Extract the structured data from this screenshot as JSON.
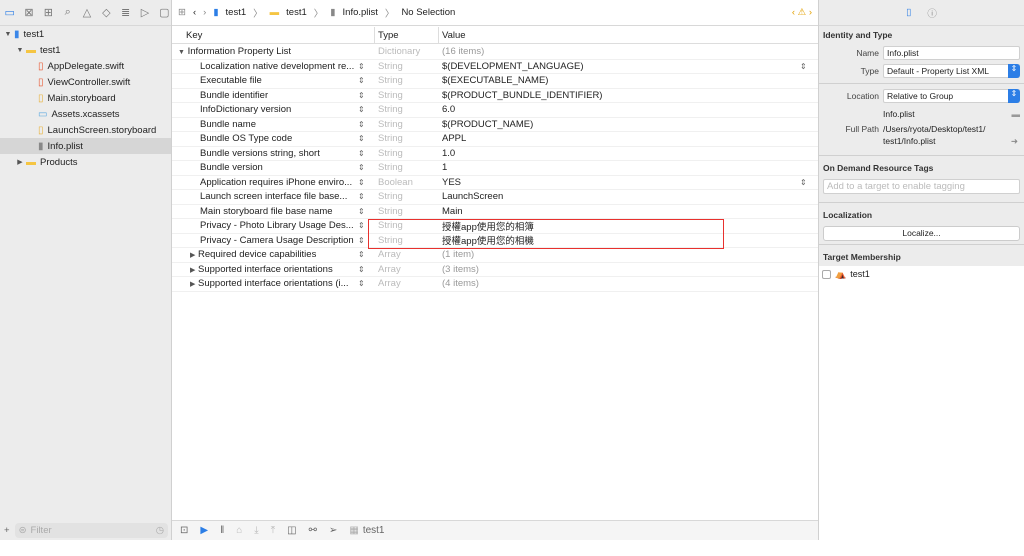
{
  "navigator": {
    "tabs": [
      "folder-icon",
      "source-control-icon",
      "hierarchy-icon",
      "search-icon",
      "warning-icon",
      "test-icon",
      "debug-icon",
      "breakpoint-icon",
      "report-icon"
    ],
    "tree": [
      {
        "label": "test1",
        "level": 0,
        "icon": "project",
        "expanded": true
      },
      {
        "label": "test1",
        "level": 1,
        "icon": "folder",
        "expanded": true
      },
      {
        "label": "AppDelegate.swift",
        "level": 2,
        "icon": "swift"
      },
      {
        "label": "ViewController.swift",
        "level": 2,
        "icon": "swift"
      },
      {
        "label": "Main.storyboard",
        "level": 2,
        "icon": "storyboard"
      },
      {
        "label": "Assets.xcassets",
        "level": 2,
        "icon": "assets"
      },
      {
        "label": "LaunchScreen.storyboard",
        "level": 2,
        "icon": "storyboard"
      },
      {
        "label": "Info.plist",
        "level": 2,
        "icon": "plist",
        "selected": true
      },
      {
        "label": "Products",
        "level": 1,
        "icon": "folder",
        "expanded": false
      }
    ],
    "filter_placeholder": "Filter"
  },
  "jumpbar": {
    "crumbs": [
      "test1",
      "test1",
      "Info.plist",
      "No Selection"
    ]
  },
  "plist": {
    "headers": {
      "key": "Key",
      "type": "Type",
      "value": "Value"
    },
    "root": {
      "key": "Information Property List",
      "type": "Dictionary",
      "value": "(16 items)"
    },
    "rows": [
      {
        "key": "Localization native development re...",
        "type": "String",
        "value": "$(DEVELOPMENT_LANGUAGE)",
        "popup": true
      },
      {
        "key": "Executable file",
        "type": "String",
        "value": "$(EXECUTABLE_NAME)"
      },
      {
        "key": "Bundle identifier",
        "type": "String",
        "value": "$(PRODUCT_BUNDLE_IDENTIFIER)"
      },
      {
        "key": "InfoDictionary version",
        "type": "String",
        "value": "6.0"
      },
      {
        "key": "Bundle name",
        "type": "String",
        "value": "$(PRODUCT_NAME)"
      },
      {
        "key": "Bundle OS Type code",
        "type": "String",
        "value": "APPL"
      },
      {
        "key": "Bundle versions string, short",
        "type": "String",
        "value": "1.0"
      },
      {
        "key": "Bundle version",
        "type": "String",
        "value": "1"
      },
      {
        "key": "Application requires iPhone enviro...",
        "type": "Boolean",
        "value": "YES",
        "popup": true
      },
      {
        "key": "Launch screen interface file base...",
        "type": "String",
        "value": "LaunchScreen"
      },
      {
        "key": "Main storyboard file base name",
        "type": "String",
        "value": "Main"
      },
      {
        "key": "Privacy - Photo Library Usage Des...",
        "type": "String",
        "value": "授權app使用您的相簿"
      },
      {
        "key": "Privacy - Camera Usage Description",
        "type": "String",
        "value": "授權app使用您的相機"
      },
      {
        "key": "Required device capabilities",
        "type": "Array",
        "value": "(1 item)",
        "collapsed": true
      },
      {
        "key": "Supported interface orientations",
        "type": "Array",
        "value": "(3 items)",
        "collapsed": true
      },
      {
        "key": "Supported interface orientations (i...",
        "type": "Array",
        "value": "(4 items)",
        "collapsed": true
      }
    ]
  },
  "debugbar": {
    "target": "test1"
  },
  "inspector": {
    "identity_title": "Identity and Type",
    "name_label": "Name",
    "name_value": "Info.plist",
    "type_label": "Type",
    "type_value": "Default - Property List XML",
    "location_label": "Location",
    "location_value": "Relative to Group",
    "location_file": "Info.plist",
    "fullpath_label": "Full Path",
    "fullpath_value1": "/Users/ryota/Desktop/test1/",
    "fullpath_value2": "test1/Info.plist",
    "odr_title": "On Demand Resource Tags",
    "odr_placeholder": "Add to a target to enable tagging",
    "loc_title": "Localization",
    "localize_button": "Localize...",
    "tm_title": "Target Membership",
    "tm_target": "test1"
  },
  "colors": {
    "accent": "#2c7ee6",
    "highlight": "#e8312e"
  }
}
